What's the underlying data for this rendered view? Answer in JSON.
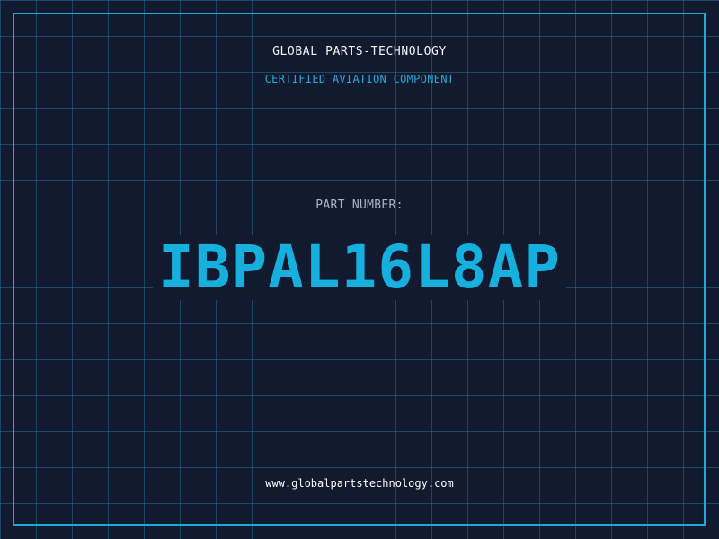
{
  "header": {
    "company": "GLOBAL PARTS-TECHNOLOGY",
    "tagline": "CERTIFIED AVIATION COMPONENT"
  },
  "part": {
    "label": "PART NUMBER:",
    "number": "IBPAL16L8AP"
  },
  "footer": {
    "website": "www.globalpartstechnology.com"
  },
  "colors": {
    "background": "#111a2f",
    "grid": "#286e8c",
    "accent": "#1ea8d6",
    "part_number": "#16b0de",
    "heading": "#f2f4f8",
    "label": "#a9b5c4"
  }
}
